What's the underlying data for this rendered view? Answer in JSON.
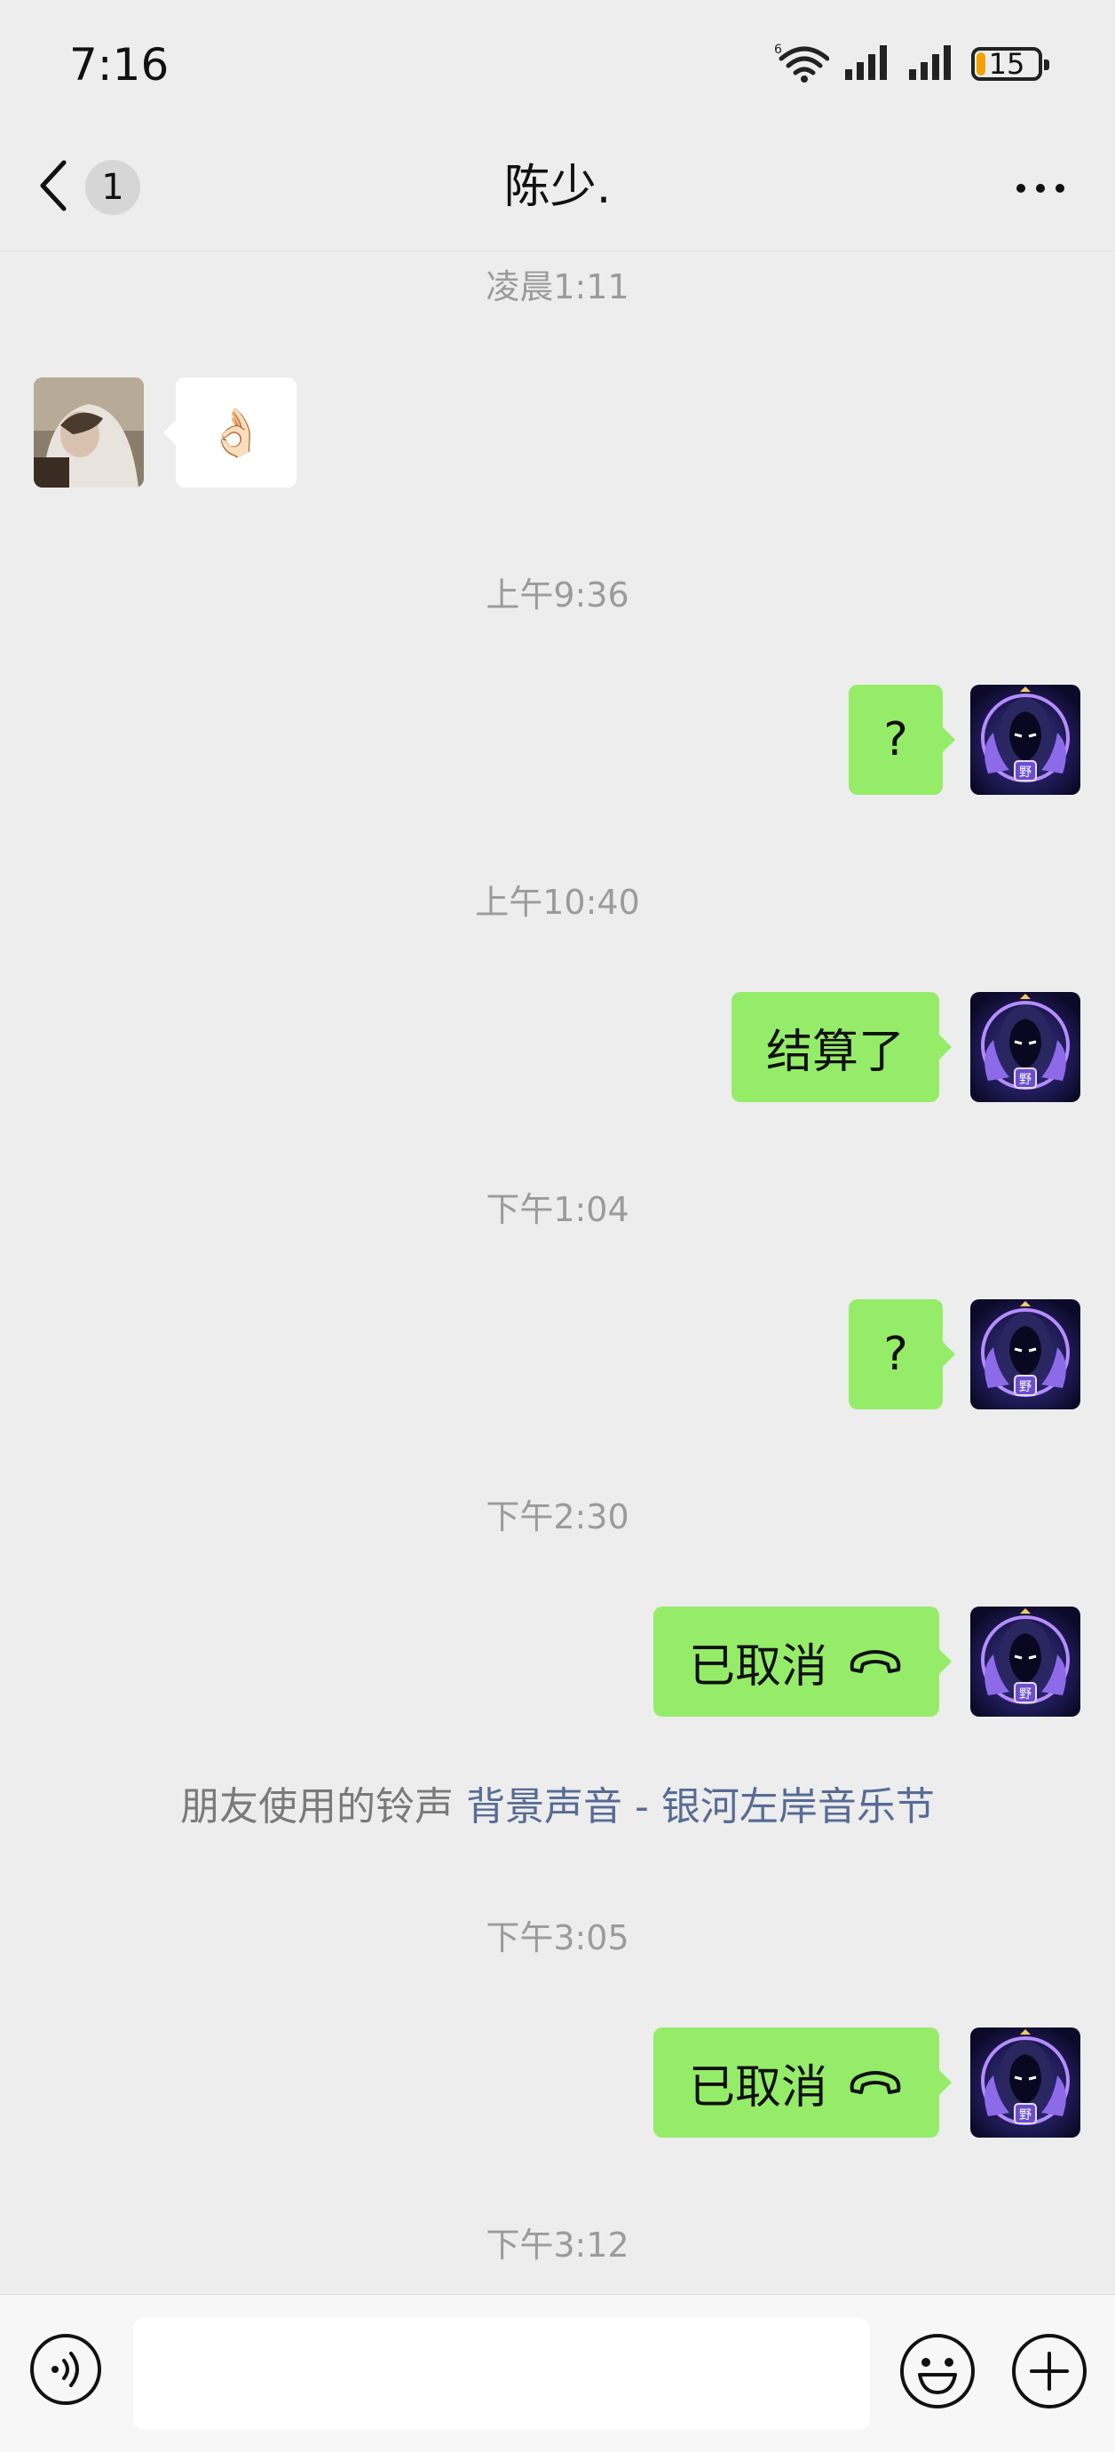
{
  "status_bar": {
    "time": "7:16",
    "network_label": "6",
    "battery_percent": 15,
    "battery_text": "15"
  },
  "header": {
    "back_badge": "1",
    "title": "陈少."
  },
  "messages": {
    "t1": "凌晨1:11",
    "peer_emoji": "👌🏻",
    "t2": "上午9:36",
    "m1": "?",
    "t3": "上午10:40",
    "m2": "结算了",
    "t4": "下午1:04",
    "m3": "?",
    "t5": "下午2:30",
    "m4": "已取消",
    "ringtone_prefix": "朋友使用的铃声",
    "ringtone_link": "背景声音 - 银河左岸音乐节",
    "t6": "下午3:05",
    "m5": "已取消",
    "t7": "下午3:12"
  },
  "input_bar": {
    "placeholder": "",
    "value": ""
  },
  "colors": {
    "background": "#ededed",
    "my_bubble": "#95ec69",
    "peer_bubble": "#ffffff",
    "link": "#576b95",
    "time_text": "#9b9b9b",
    "battery": "#f2a100"
  },
  "icons": [
    "wifi-icon",
    "signal-icon",
    "battery-icon",
    "back-arrow-icon",
    "more-icon",
    "hangup-icon",
    "voice-icon",
    "emoji-icon",
    "plus-icon"
  ]
}
